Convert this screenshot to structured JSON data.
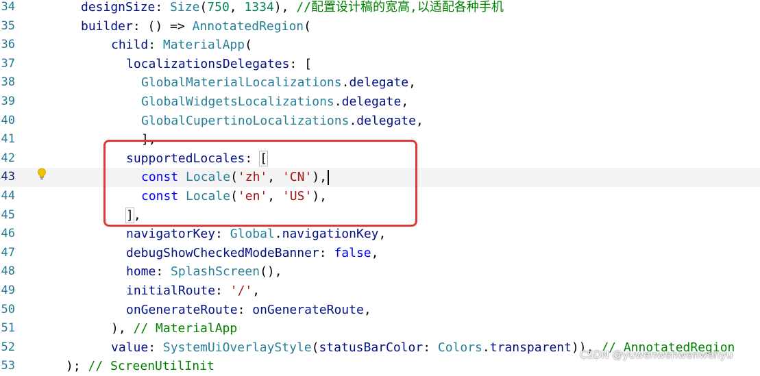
{
  "editor": {
    "current_line": "43",
    "lines": [
      {
        "num": "34",
        "tokens": [
          {
            "t": "designSize",
            "c": "k"
          },
          {
            "t": ": ",
            "c": "p"
          },
          {
            "t": "Size",
            "c": "t"
          },
          {
            "t": "(",
            "c": "p"
          },
          {
            "t": "750",
            "c": "n"
          },
          {
            "t": ", ",
            "c": "p"
          },
          {
            "t": "1334",
            "c": "n"
          },
          {
            "t": "), ",
            "c": "p"
          },
          {
            "t": "//配置设计稿的宽高,以适配各种手机",
            "c": "c"
          }
        ]
      },
      {
        "num": "35",
        "tokens": [
          {
            "t": "builder",
            "c": "k"
          },
          {
            "t": ": () => ",
            "c": "p"
          },
          {
            "t": "AnnotatedRegion",
            "c": "t"
          },
          {
            "t": "(",
            "c": "p"
          }
        ]
      },
      {
        "num": "36",
        "tokens": [
          {
            "t": "child",
            "c": "k"
          },
          {
            "t": ": ",
            "c": "p"
          },
          {
            "t": "MaterialApp",
            "c": "t"
          },
          {
            "t": "(",
            "c": "p"
          }
        ]
      },
      {
        "num": "37",
        "tokens": [
          {
            "t": "localizationsDelegates",
            "c": "k"
          },
          {
            "t": ": [",
            "c": "p"
          }
        ]
      },
      {
        "num": "38",
        "tokens": [
          {
            "t": "GlobalMaterialLocalizations",
            "c": "t"
          },
          {
            "t": ".",
            "c": "p"
          },
          {
            "t": "delegate",
            "c": "k"
          },
          {
            "t": ",",
            "c": "p"
          }
        ]
      },
      {
        "num": "39",
        "tokens": [
          {
            "t": "GlobalWidgetsLocalizations",
            "c": "t"
          },
          {
            "t": ".",
            "c": "p"
          },
          {
            "t": "delegate",
            "c": "k"
          },
          {
            "t": ",",
            "c": "p"
          }
        ]
      },
      {
        "num": "40",
        "tokens": [
          {
            "t": "GlobalCupertinoLocalizations",
            "c": "t"
          },
          {
            "t": ".",
            "c": "p"
          },
          {
            "t": "delegate",
            "c": "k"
          },
          {
            "t": ",",
            "c": "p"
          }
        ]
      },
      {
        "num": "41",
        "tokens": [
          {
            "t": "],",
            "c": "p"
          }
        ]
      },
      {
        "num": "42",
        "tokens": [
          {
            "t": "supportedLocales",
            "c": "k"
          },
          {
            "t": ": ",
            "c": "p"
          },
          {
            "t": "[",
            "c": "p",
            "hl": true
          }
        ]
      },
      {
        "num": "43",
        "tokens": [
          {
            "t": "const",
            "c": "b"
          },
          {
            "t": " ",
            "c": "p"
          },
          {
            "t": "Locale",
            "c": "t"
          },
          {
            "t": "(",
            "c": "p"
          },
          {
            "t": "'zh'",
            "c": "s"
          },
          {
            "t": ", ",
            "c": "p"
          },
          {
            "t": "'CN'",
            "c": "s"
          },
          {
            "t": "),",
            "c": "p"
          }
        ]
      },
      {
        "num": "44",
        "tokens": [
          {
            "t": "const",
            "c": "b"
          },
          {
            "t": " ",
            "c": "p"
          },
          {
            "t": "Locale",
            "c": "t"
          },
          {
            "t": "(",
            "c": "p"
          },
          {
            "t": "'en'",
            "c": "s"
          },
          {
            "t": ", ",
            "c": "p"
          },
          {
            "t": "'US'",
            "c": "s"
          },
          {
            "t": "),",
            "c": "p"
          }
        ]
      },
      {
        "num": "45",
        "tokens": [
          {
            "t": "]",
            "c": "p",
            "hl": true
          },
          {
            "t": ",",
            "c": "p"
          }
        ]
      },
      {
        "num": "46",
        "tokens": [
          {
            "t": "navigatorKey",
            "c": "k"
          },
          {
            "t": ": ",
            "c": "p"
          },
          {
            "t": "Global",
            "c": "t"
          },
          {
            "t": ".",
            "c": "p"
          },
          {
            "t": "navigationKey",
            "c": "k"
          },
          {
            "t": ",",
            "c": "p"
          }
        ]
      },
      {
        "num": "47",
        "tokens": [
          {
            "t": "debugShowCheckedModeBanner",
            "c": "k"
          },
          {
            "t": ": ",
            "c": "p"
          },
          {
            "t": "false",
            "c": "b"
          },
          {
            "t": ",",
            "c": "p"
          }
        ]
      },
      {
        "num": "48",
        "tokens": [
          {
            "t": "home",
            "c": "k"
          },
          {
            "t": ": ",
            "c": "p"
          },
          {
            "t": "SplashScreen",
            "c": "t"
          },
          {
            "t": "(),",
            "c": "p"
          }
        ]
      },
      {
        "num": "49",
        "tokens": [
          {
            "t": "initialRoute",
            "c": "k"
          },
          {
            "t": ": ",
            "c": "p"
          },
          {
            "t": "'/'",
            "c": "s"
          },
          {
            "t": ",",
            "c": "p"
          }
        ]
      },
      {
        "num": "50",
        "tokens": [
          {
            "t": "onGenerateRoute",
            "c": "k"
          },
          {
            "t": ": ",
            "c": "p"
          },
          {
            "t": "onGenerateRoute",
            "c": "k"
          },
          {
            "t": ",",
            "c": "p"
          }
        ]
      },
      {
        "num": "51",
        "tokens": [
          {
            "t": "), ",
            "c": "p"
          },
          {
            "t": "// MaterialApp",
            "c": "c"
          }
        ]
      },
      {
        "num": "52",
        "tokens": [
          {
            "t": "value",
            "c": "k"
          },
          {
            "t": ": ",
            "c": "p"
          },
          {
            "t": "SystemUiOverlayStyle",
            "c": "t"
          },
          {
            "t": "(",
            "c": "p"
          },
          {
            "t": "statusBarColor",
            "c": "k"
          },
          {
            "t": ": ",
            "c": "p"
          },
          {
            "t": "Colors",
            "c": "t"
          },
          {
            "t": ".",
            "c": "p"
          },
          {
            "t": "transparent",
            "c": "k"
          },
          {
            "t": ")), ",
            "c": "p"
          },
          {
            "t": "// AnnotatedRegion",
            "c": "c"
          }
        ]
      },
      {
        "num": "53",
        "tokens": [
          {
            "t": "); ",
            "c": "p"
          },
          {
            "t": "// ScreenUtilInit",
            "c": "c"
          }
        ]
      }
    ]
  },
  "lightbulb_icon": "lightbulb-icon",
  "watermark": "CSDN @yuwenwenwenwenyu",
  "colors": {
    "highlight_box": "#e03838",
    "line_number": "#237893",
    "current_line_bg": "#f3f3f3"
  }
}
